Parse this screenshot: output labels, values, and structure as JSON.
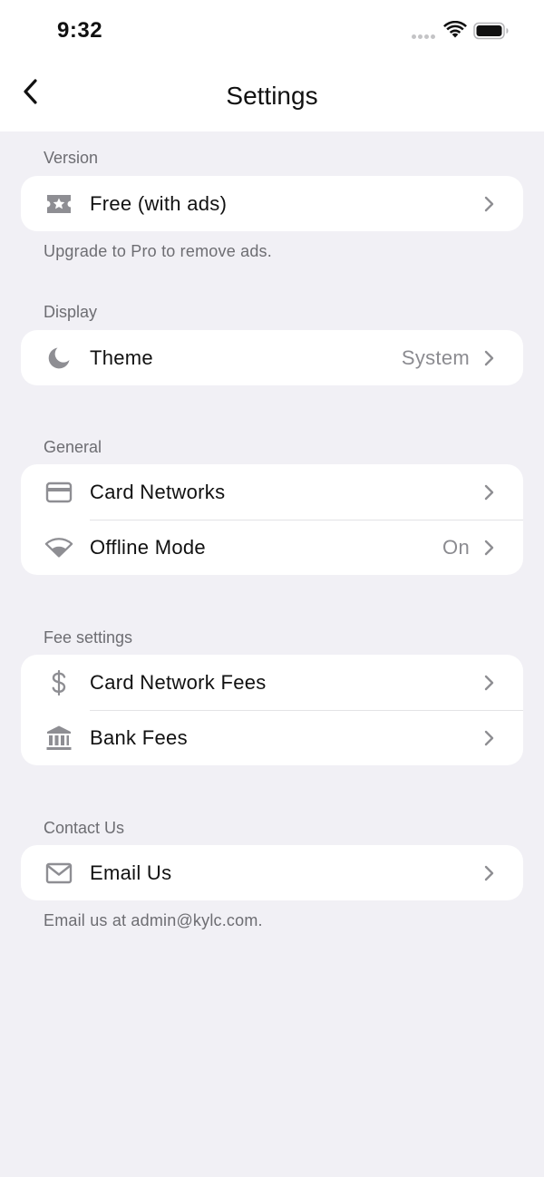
{
  "status_bar": {
    "time": "9:32"
  },
  "nav": {
    "title": "Settings"
  },
  "sections": {
    "version": {
      "label": "Version",
      "item": {
        "label": "Free (with ads)",
        "icon": "ticket-star-icon"
      },
      "footnote": "Upgrade to Pro to remove ads."
    },
    "display": {
      "label": "Display",
      "item": {
        "label": "Theme",
        "value": "System",
        "icon": "moon-icon"
      }
    },
    "general": {
      "label": "General",
      "items": [
        {
          "label": "Card Networks",
          "icon": "credit-card-icon"
        },
        {
          "label": "Offline Mode",
          "value": "On",
          "icon": "wifi-icon"
        }
      ]
    },
    "fees": {
      "label": "Fee settings",
      "items": [
        {
          "label": "Card Network Fees",
          "icon": "dollar-sign-icon"
        },
        {
          "label": "Bank Fees",
          "icon": "bank-icon"
        }
      ]
    },
    "contact": {
      "label": "Contact Us",
      "item": {
        "label": "Email Us",
        "icon": "envelope-icon"
      },
      "footnote": "Email us at admin@kylc.com."
    }
  },
  "colors": {
    "background": "#f1f0f5",
    "card": "#ffffff",
    "icon": "#8e8e93",
    "secondary_text": "#6d6d72"
  }
}
